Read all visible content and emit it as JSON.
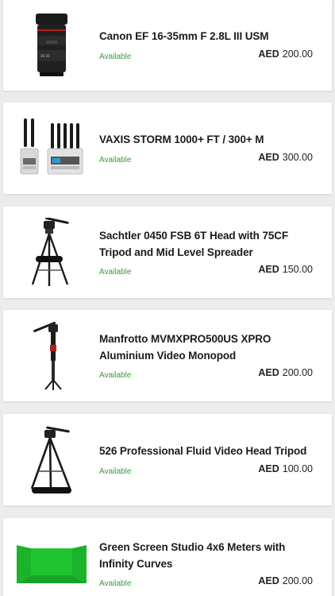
{
  "colors": {
    "background": "#ececec",
    "card": "#ffffff",
    "title": "#1b1b1b",
    "available": "#3a9a3a",
    "price": "#222222"
  },
  "products": [
    {
      "title": "Canon EF 16-35mm F 2.8L III USM",
      "status": "Available",
      "currency": "AED",
      "price": "200.00",
      "icon": "camera-lens-icon"
    },
    {
      "title": "VAXIS STORM 1000+ FT / 300+ M",
      "status": "Available",
      "currency": "AED",
      "price": "300.00",
      "icon": "wireless-video-transmitter-icon"
    },
    {
      "title": "Sachtler 0450 FSB 6T Head with 75CF Tripod and Mid Level Spreader",
      "status": "Available",
      "currency": "AED",
      "price": "150.00",
      "icon": "tripod-icon"
    },
    {
      "title": "Manfrotto MVMXPRO500US XPRO Aluminium Video Monopod",
      "status": "Available",
      "currency": "AED",
      "price": "200.00",
      "icon": "monopod-icon"
    },
    {
      "title": "526 Professional Fluid Video Head Tripod",
      "status": "Available",
      "currency": "AED",
      "price": "100.00",
      "icon": "tripod-with-bag-icon"
    },
    {
      "title": "Green Screen Studio 4x6 Meters with Infinity Curves",
      "status": "Available",
      "currency": "AED",
      "price": "200.00",
      "icon": "green-screen-icon"
    }
  ]
}
